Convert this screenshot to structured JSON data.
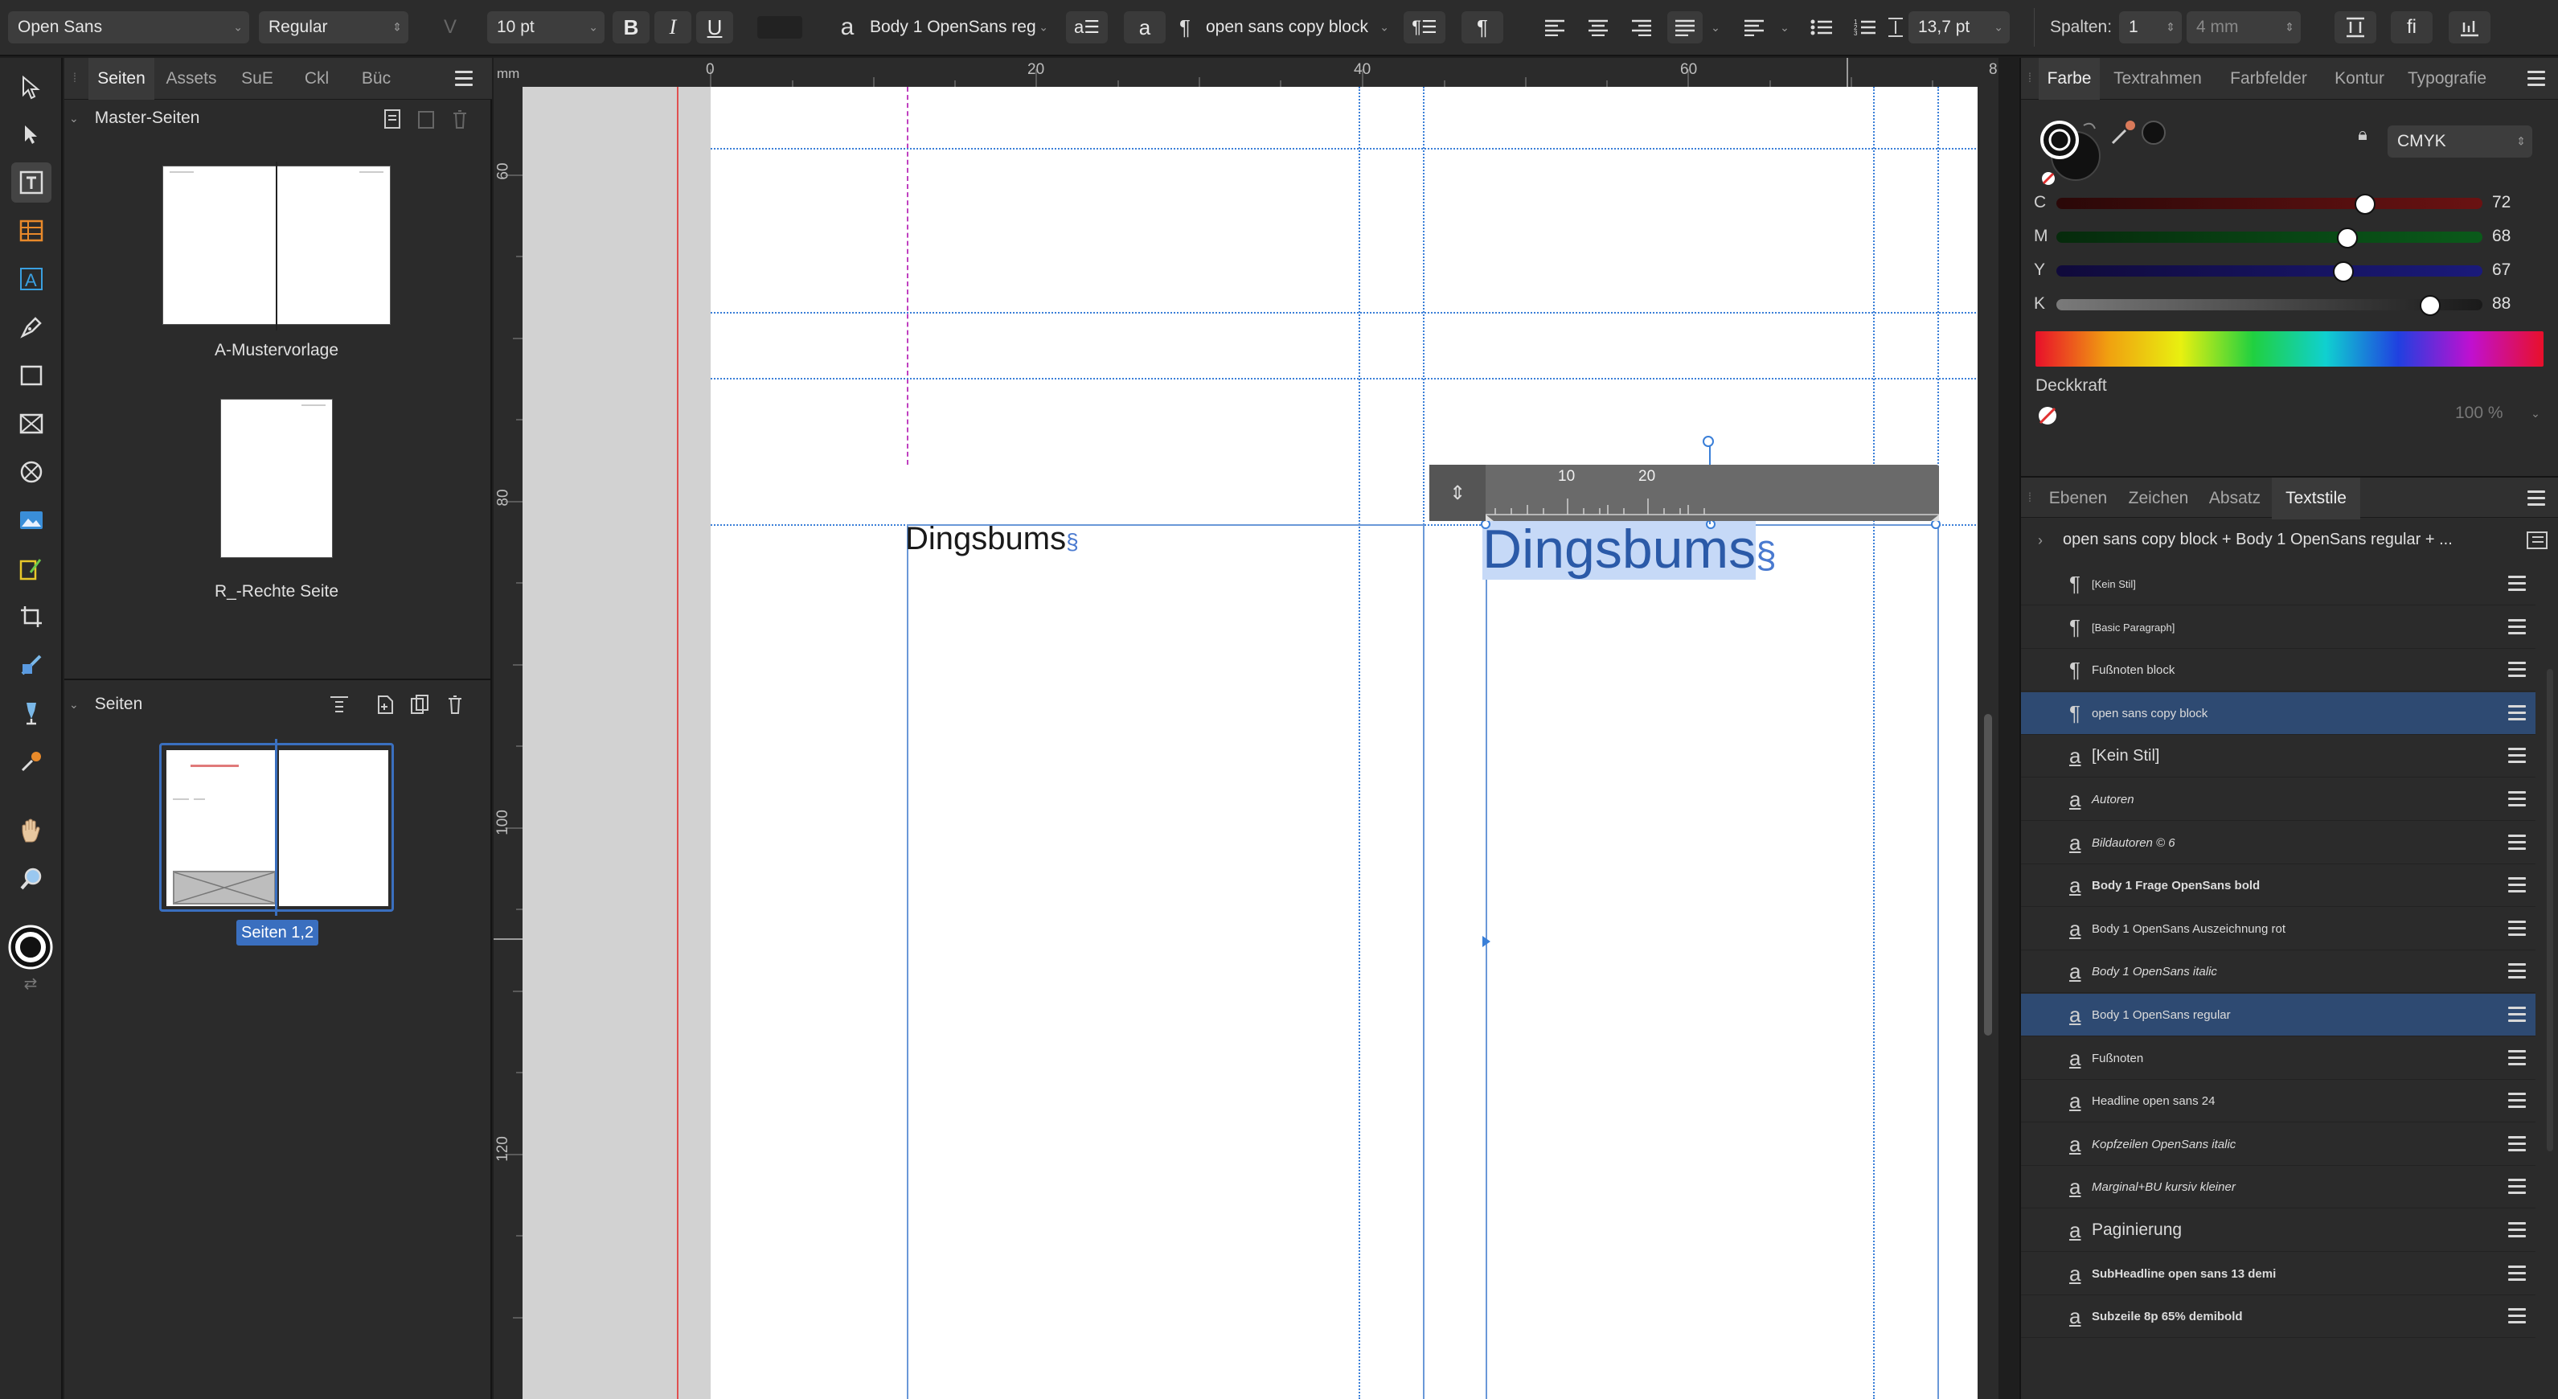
{
  "toolbar": {
    "font_family": "Open Sans",
    "font_style": "Regular",
    "font_size": "10 pt",
    "bold": "B",
    "italic": "I",
    "underline": "U",
    "char_style_glyph": "a",
    "char_style": "Body 1 OpenSans reg",
    "para_style_glyph": "¶",
    "para_style": "open sans copy block",
    "leading": "13,7 pt",
    "columns_label": "Spalten:",
    "columns_value": "1",
    "gutter_value": "4 mm",
    "ligature_label": "fi"
  },
  "left_panel": {
    "tabs": [
      "Seiten",
      "Assets",
      "SuE",
      "Ckl",
      "Büc"
    ],
    "master_header": "Master-Seiten",
    "masters": [
      "A-Mustervorlage",
      "R_-Rechte Seite"
    ],
    "pages_header": "Seiten",
    "pages_label": "Seiten 1,2"
  },
  "ruler": {
    "unit": "mm",
    "h_ticks": [
      "0",
      "20",
      "40",
      "60",
      "8"
    ],
    "v_ticks": [
      "60",
      "80",
      "100",
      "120"
    ]
  },
  "canvas": {
    "text_left": "Dingsbums",
    "text_right": "Dingsbums",
    "pilcrow": "§",
    "inline_ruler_ticks": [
      "10",
      "20"
    ]
  },
  "color_panel": {
    "tabs": [
      "Farbe",
      "Textrahmen",
      "Farbfelder",
      "Kontur",
      "Typografie"
    ],
    "model": "CMYK",
    "channels": [
      {
        "label": "C",
        "value": 72,
        "color": "#1aa0d8"
      },
      {
        "label": "M",
        "value": 68,
        "color": "#d01a6a"
      },
      {
        "label": "Y",
        "value": 67,
        "color": "#e8d21a"
      },
      {
        "label": "K",
        "value": 88,
        "color": "#9a9a9a"
      }
    ],
    "opacity_label": "Deckkraft",
    "opacity_value": "100 %"
  },
  "styles_panel": {
    "tabs": [
      "Ebenen",
      "Zeichen",
      "Absatz",
      "Textstile"
    ],
    "path": "open sans copy block + Body 1 OpenSans regular + ...",
    "items": [
      {
        "glyph": "¶",
        "name": "[Kein Stil]",
        "size": 13,
        "style": "normal",
        "weight": "normal",
        "selected": false
      },
      {
        "glyph": "¶",
        "name": "[Basic Paragraph]",
        "size": 13,
        "style": "normal",
        "weight": "normal",
        "selected": false
      },
      {
        "glyph": "¶",
        "name": "Fußnoten block",
        "size": 15,
        "style": "normal",
        "weight": "normal",
        "selected": false
      },
      {
        "glyph": "¶",
        "name": "open sans copy block",
        "size": 15,
        "style": "normal",
        "weight": "normal",
        "selected": true
      },
      {
        "glyph": "a",
        "name": "[Kein Stil]",
        "size": 20,
        "style": "normal",
        "weight": "normal",
        "selected": false
      },
      {
        "glyph": "a",
        "name": "Autoren",
        "size": 15,
        "style": "italic",
        "weight": "normal",
        "selected": false
      },
      {
        "glyph": "a",
        "name": "Bildautoren © 6",
        "size": 15,
        "style": "italic",
        "weight": "normal",
        "selected": false
      },
      {
        "glyph": "a",
        "name": "Body 1 Frage OpenSans bold",
        "size": 15,
        "style": "normal",
        "weight": "bold",
        "selected": false
      },
      {
        "glyph": "a",
        "name": "Body 1 OpenSans Auszeichnung rot",
        "size": 15,
        "style": "normal",
        "weight": "normal",
        "selected": false
      },
      {
        "glyph": "a",
        "name": "Body 1 OpenSans italic",
        "size": 15,
        "style": "italic",
        "weight": "normal",
        "selected": false
      },
      {
        "glyph": "a",
        "name": "Body 1 OpenSans regular",
        "size": 15,
        "style": "normal",
        "weight": "normal",
        "selected": true
      },
      {
        "glyph": "a",
        "name": "Fußnoten",
        "size": 15,
        "style": "normal",
        "weight": "normal",
        "selected": false
      },
      {
        "glyph": "a",
        "name": "Headline open sans 24",
        "size": 15,
        "style": "normal",
        "weight": "normal",
        "selected": false
      },
      {
        "glyph": "a",
        "name": "Kopfzeilen OpenSans italic",
        "size": 15,
        "style": "italic",
        "weight": "normal",
        "selected": false
      },
      {
        "glyph": "a",
        "name": "Marginal+BU  kursiv kleiner",
        "size": 15,
        "style": "italic",
        "weight": "normal",
        "selected": false
      },
      {
        "glyph": "a",
        "name": "Paginierung",
        "size": 21,
        "style": "normal",
        "weight": "normal",
        "selected": false
      },
      {
        "glyph": "a",
        "name": "SubHeadline open sans 13 demi",
        "size": 15,
        "style": "normal",
        "weight": "bold",
        "selected": false
      },
      {
        "glyph": "a",
        "name": "Subzeile 8p 65% demibold",
        "size": 15,
        "style": "normal",
        "weight": "bold",
        "selected": false
      }
    ]
  },
  "colors": {
    "accent": "#3a7fd8",
    "selection": "#2e4a72",
    "text_selected_bg": "#c6d9f7",
    "text_blue": "#2b5aa8"
  }
}
